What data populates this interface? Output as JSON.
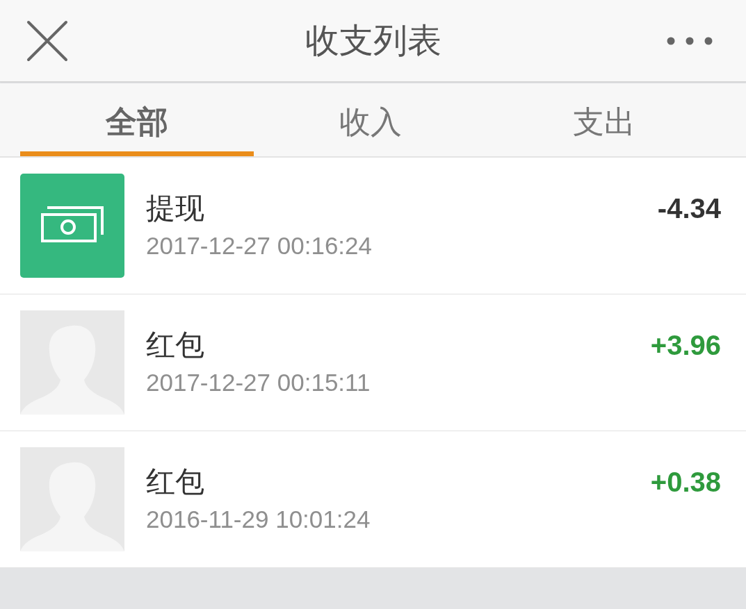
{
  "header": {
    "title": "收支列表"
  },
  "tabs": [
    {
      "label": "全部",
      "selected": true
    },
    {
      "label": "收入",
      "selected": false
    },
    {
      "label": "支出",
      "selected": false
    }
  ],
  "transactions": [
    {
      "kind": "withdrawal",
      "title": "提现",
      "time": "2017-12-27 00:16:24",
      "amount": "-4.34",
      "color": "#333333"
    },
    {
      "kind": "red_packet",
      "title": "红包",
      "time": "2017-12-27 00:15:11",
      "amount": "+3.96",
      "color": "#2e9a3c"
    },
    {
      "kind": "red_packet",
      "title": "红包",
      "time": "2016-11-29 10:01:24",
      "amount": "+0.38",
      "color": "#2e9a3c"
    }
  ]
}
